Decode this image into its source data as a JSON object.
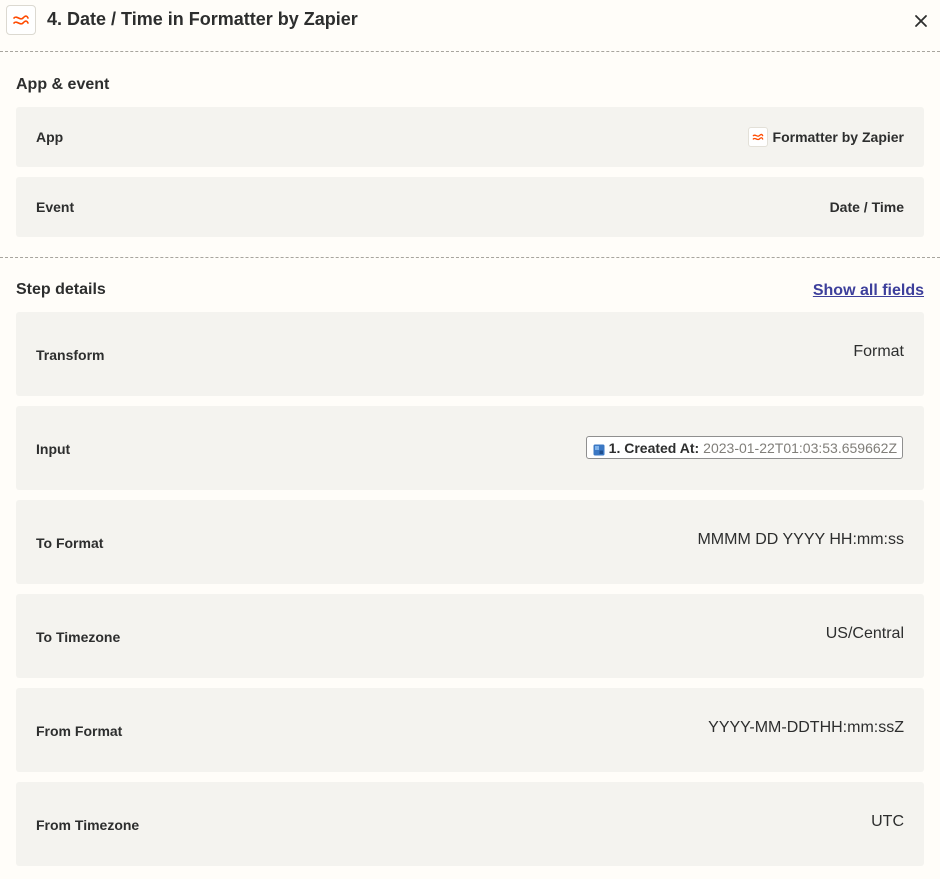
{
  "header": {
    "title": "4. Date / Time in Formatter by Zapier",
    "app_icon": "formatter-icon",
    "close_icon": "close-icon"
  },
  "app_event": {
    "title": "App & event",
    "rows": [
      {
        "label": "App",
        "value": "Formatter by Zapier",
        "icon": "formatter-icon"
      },
      {
        "label": "Event",
        "value": "Date / Time"
      }
    ]
  },
  "step_details": {
    "title": "Step details",
    "show_all_label": "Show all fields",
    "rows": [
      {
        "label": "Transform",
        "value": "Format"
      },
      {
        "label": "Input",
        "pill_key": "1. Created At:",
        "pill_value": "2023-01-22T01:03:53.659662Z",
        "pill_icon": "database-icon"
      },
      {
        "label": "To Format",
        "value": "MMMM DD YYYY HH:mm:ss"
      },
      {
        "label": "To Timezone",
        "value": "US/Central"
      },
      {
        "label": "From Format",
        "value": "YYYY-MM-DDTHH:mm:ssZ"
      },
      {
        "label": "From Timezone",
        "value": "UTC"
      }
    ]
  },
  "colors": {
    "accent_orange": "#ff4a00",
    "link": "#3d3f9b",
    "row_bg": "#f4f3ef",
    "page_bg": "#fffdf9"
  }
}
